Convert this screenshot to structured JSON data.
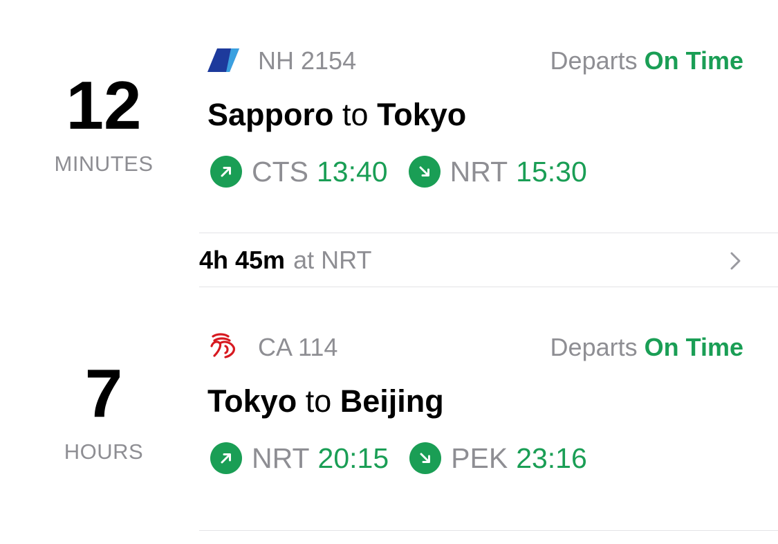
{
  "flights": [
    {
      "countdown_value": "12",
      "countdown_unit": "MINUTES",
      "airline_icon": "ana-logo-icon",
      "flight_number": "NH 2154",
      "status_label": "Departs",
      "status_value": "On Time",
      "origin_city": "Sapporo",
      "to_word": "to",
      "destination_city": "Tokyo",
      "departure_code": "CTS",
      "departure_time": "13:40",
      "arrival_code": "NRT",
      "arrival_time": "15:30"
    },
    {
      "countdown_value": "7",
      "countdown_unit": "HOURS",
      "airline_icon": "air-china-logo-icon",
      "flight_number": "CA 114",
      "status_label": "Departs",
      "status_value": "On Time",
      "origin_city": "Tokyo",
      "to_word": "to",
      "destination_city": "Beijing",
      "departure_code": "NRT",
      "departure_time": "20:15",
      "arrival_code": "PEK",
      "arrival_time": "23:16"
    }
  ],
  "layover": {
    "duration": "4h 45m",
    "location_text": "at NRT"
  },
  "colors": {
    "on_time_green": "#1a9e55",
    "secondary_gray": "#8e8e93",
    "ana_blue": "#1d3a9c",
    "air_china_red": "#d71920"
  }
}
